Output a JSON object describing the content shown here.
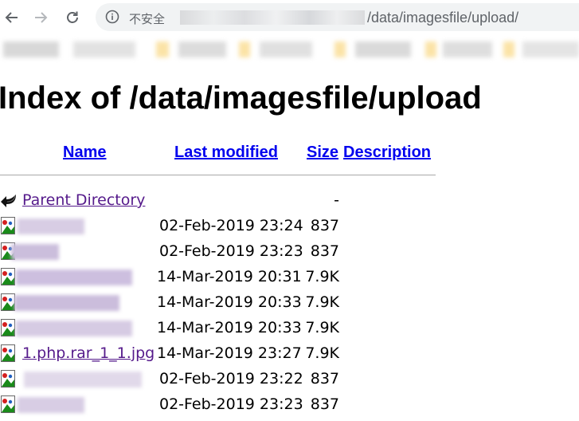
{
  "browser": {
    "security_label": "不安全",
    "url_path": "/data/imagesfile/upload/"
  },
  "page": {
    "title": "Index of /data/imagesfile/upload"
  },
  "columns": {
    "name": "Name",
    "last_modified": "Last modified",
    "size": "Size",
    "description": "Description"
  },
  "parent": {
    "label": "Parent Directory",
    "size": "-"
  },
  "files": [
    {
      "name": "",
      "last_modified": "02-Feb-2019 23:24",
      "size": "837"
    },
    {
      "name": "",
      "last_modified": "02-Feb-2019 23:23",
      "size": "837"
    },
    {
      "name": "",
      "last_modified": "14-Mar-2019 20:31",
      "size": "7.9K"
    },
    {
      "name": "",
      "last_modified": "14-Mar-2019 20:33",
      "size": "7.9K"
    },
    {
      "name": "",
      "last_modified": "14-Mar-2019 20:33",
      "size": "7.9K"
    },
    {
      "name": "1.php.rar_1_1.jpg",
      "last_modified": "14-Mar-2019 23:27",
      "size": "7.9K"
    },
    {
      "name": "",
      "last_modified": "02-Feb-2019 23:22",
      "size": "837"
    },
    {
      "name": "",
      "last_modified": "02-Feb-2019 23:23",
      "size": "837"
    }
  ],
  "icons": {
    "back": "back-arrow-icon",
    "forward": "forward-arrow-icon",
    "reload": "reload-icon",
    "info": "info-icon",
    "parent": "parent-directory-icon",
    "file": "image-file-icon"
  },
  "colors": {
    "link": "#0000ee",
    "visited_link": "#551a8b",
    "omnibox_bg": "#f1f3f4",
    "chrome_icon": "#5f6368"
  }
}
